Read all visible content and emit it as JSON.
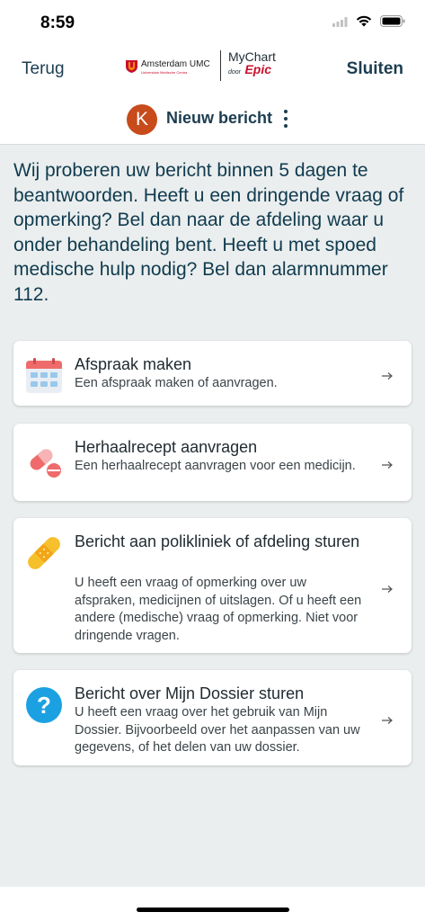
{
  "status_bar": {
    "time": "8:59"
  },
  "nav": {
    "back_label": "Terug",
    "close_label": "Sluiten",
    "umc_name": "Amsterdam UMC",
    "umc_subtitle": "Universitair Medische Centra",
    "mychart_label": "MyChart",
    "door_label": "door",
    "epic_label": "Epic"
  },
  "conversation": {
    "avatar_letter": "K",
    "title": "Nieuw bericht"
  },
  "intro_text": "Wij proberen uw bericht binnen 5 dagen te beantwoorden. Heeft u een dringende vraag of opmerking? Bel dan naar de afdeling waar u onder behandeling bent. Heeft u met spoed medische hulp nodig? Bel dan alarmnummer 112.",
  "options": [
    {
      "icon": "calendar-icon",
      "title": "Afspraak maken",
      "description": "Een afspraak maken of aanvragen."
    },
    {
      "icon": "pill-icon",
      "title": "Herhaalrecept aanvragen",
      "description": "Een herhaalrecept aanvragen voor een medicijn."
    },
    {
      "icon": "bandage-icon",
      "title": "Bericht aan polikliniek of afdeling sturen",
      "description": "U heeft een vraag of opmerking over uw afspraken, medicijnen of uitslagen. Of u heeft een andere (medische) vraag of opmerking. Niet voor dringende vragen."
    },
    {
      "icon": "question-icon",
      "title": "Bericht over Mijn Dossier sturen",
      "description": "U heeft een vraag over het gebruik van Mijn Dossier. Bijvoorbeeld over het aanpassen van uw gegevens, of het delen van uw dossier."
    }
  ],
  "colors": {
    "accent": "#1c3d50",
    "brand_red": "#c8102e",
    "avatar": "#c84b1b",
    "background": "#ebeeee"
  }
}
